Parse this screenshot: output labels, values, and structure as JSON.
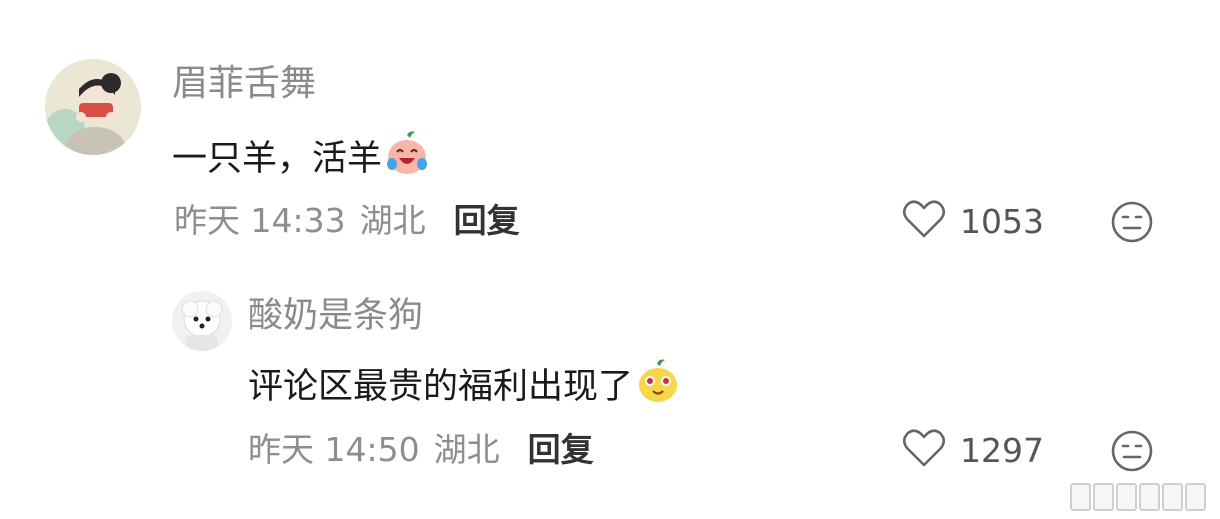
{
  "comments": [
    {
      "username": "眉菲舌舞",
      "text": "一只羊，活羊",
      "emoji": "cry-laugh-peach",
      "time": "昨天 14:33",
      "location": "湖北",
      "reply_label": "回复",
      "likes": "1053"
    },
    {
      "username": "酸奶是条狗",
      "text": "评论区最贵的福利出现了",
      "emoji": "drool-yellow-face",
      "time": "昨天 14:50",
      "location": "湖北",
      "reply_label": "回复",
      "likes": "1297"
    }
  ]
}
